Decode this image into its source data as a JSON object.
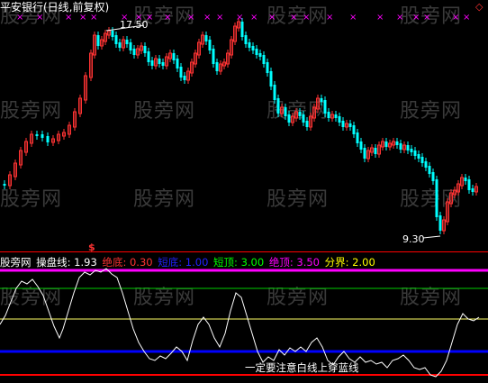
{
  "header": {
    "title": "平安银行(日线,前复权)",
    "title_color": "#ffffff"
  },
  "price_chart": {
    "high_label": "17.50",
    "low_label": "9.30",
    "up_color": "#ff3333",
    "down_color": "#00ffff",
    "marker_color": "#ff00ff",
    "marker_glyph": "×",
    "right_marker_glyph": "◇"
  },
  "indicator": {
    "name": "股旁网",
    "signal_mark": "$",
    "items": [
      {
        "label": "操盘线:",
        "value": "1.93",
        "color": "#ffffff"
      },
      {
        "label": "绝底:",
        "value": "0.30",
        "color": "#ff3333"
      },
      {
        "label": "短底:",
        "value": "1.00",
        "color": "#2222ff"
      },
      {
        "label": "短顶:",
        "value": "3.00",
        "color": "#00ff00"
      },
      {
        "label": "绝顶:",
        "value": "3.50",
        "color": "#ff00ff"
      },
      {
        "label": "分界:",
        "value": "2.00",
        "color": "#ffff00"
      }
    ],
    "annotation": "一定要注意白线上穿蓝线",
    "line_colors": {
      "top": "#ff00ff",
      "short_top": "#00cc00",
      "divider": "#ffff66",
      "short_bottom": "#0000ff",
      "bottom": "#ff0000"
    }
  },
  "watermark": "股旁网"
}
